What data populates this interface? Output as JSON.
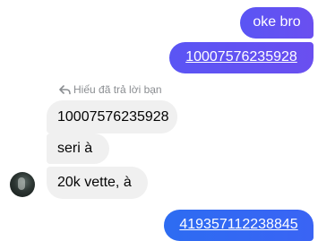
{
  "messages": {
    "outgoing_1": "oke bro",
    "outgoing_2": "10007576235928",
    "reply_note": "Hiếu đã trả lời bạn",
    "incoming_1": "10007576235928",
    "incoming_2": "seri à",
    "incoming_3": "20k vette, à",
    "outgoing_3": "419357112238845"
  },
  "icons": {
    "reply": "reply-arrow-icon",
    "avatar": "contact-avatar"
  },
  "colors": {
    "outgoing_bubble": "#5a55f4",
    "outgoing_bubble_alt": "#2d6cf2",
    "incoming_bubble": "#f0f0f0",
    "meta_text": "#8a8d91"
  }
}
